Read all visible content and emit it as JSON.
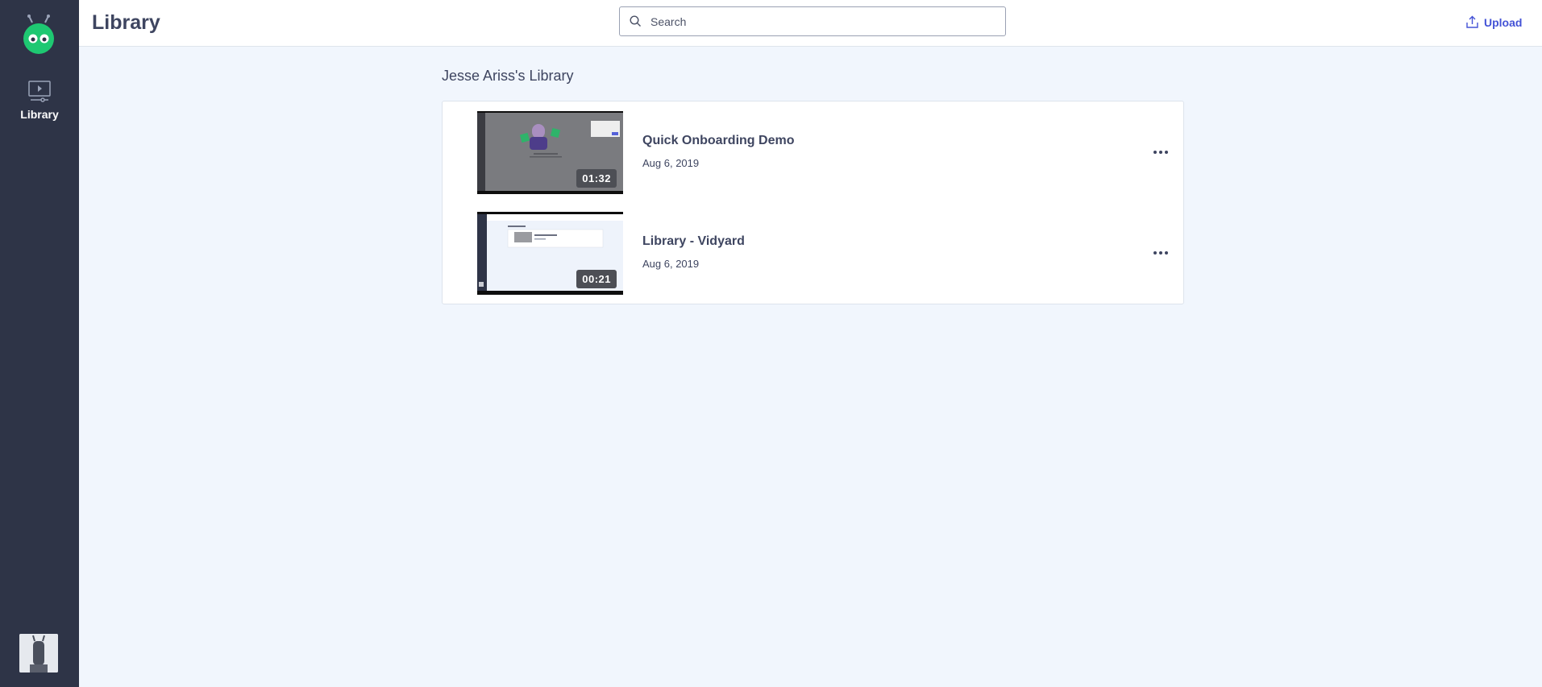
{
  "sidebar": {
    "nav_label": "Library"
  },
  "header": {
    "title": "Library",
    "search_placeholder": "Search",
    "upload_label": "Upload"
  },
  "library": {
    "heading": "Jesse Ariss's Library",
    "videos": [
      {
        "title": "Quick Onboarding Demo",
        "date": "Aug 6, 2019",
        "duration": "01:32"
      },
      {
        "title": "Library - Vidyard",
        "date": "Aug 6, 2019",
        "duration": "00:21"
      }
    ]
  },
  "colors": {
    "sidebar": "#2e3447",
    "background": "#f1f6fd",
    "accent": "#4453d6",
    "logo": "#1ec872",
    "text": "#3e4560"
  }
}
